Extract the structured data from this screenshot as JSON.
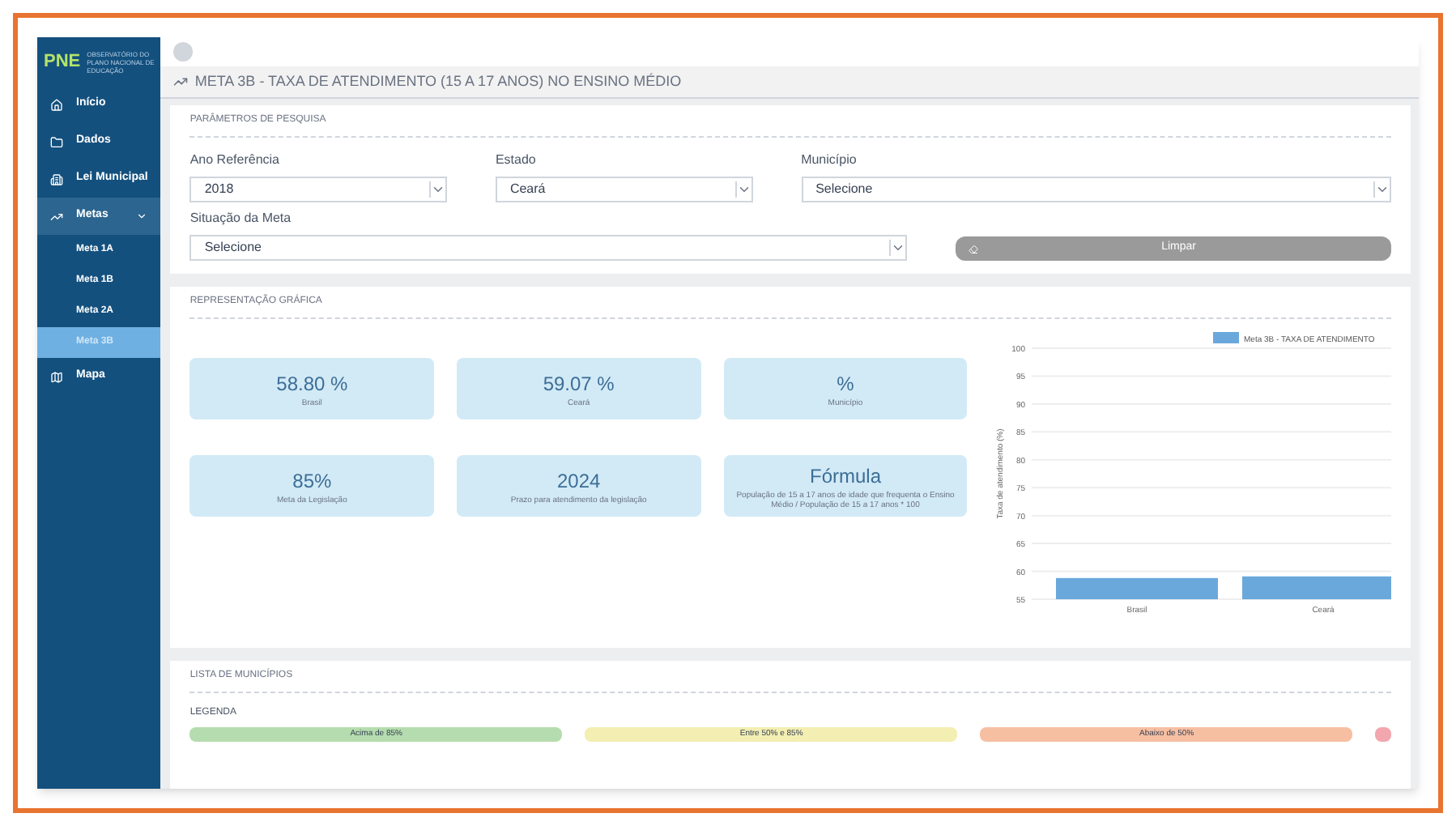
{
  "brand": {
    "logo": "PNE",
    "subtitle": "OBSERVATÓRIO DO PLANO NACIONAL DE EDUCAÇÃO"
  },
  "sidebar": {
    "items": [
      {
        "label": "Início",
        "selected": false
      },
      {
        "label": "Dados",
        "selected": false
      },
      {
        "label": "Lei Municipal",
        "selected": false
      },
      {
        "label": "Metas",
        "selected": true,
        "expanded": true,
        "children": [
          {
            "label": "Meta 1A",
            "selected": false
          },
          {
            "label": "Meta 1B",
            "selected": false
          },
          {
            "label": "Meta 2A",
            "selected": false
          },
          {
            "label": "Meta 3B",
            "selected": true
          }
        ]
      },
      {
        "label": "Mapa",
        "selected": false
      }
    ]
  },
  "header": {
    "title": "META 3B - TAXA DE ATENDIMENTO (15 A 17 ANOS) NO ENSINO MÉDIO"
  },
  "search": {
    "title": "PARÂMETROS DE PESQUISA",
    "fields": [
      {
        "label": "Ano Referência",
        "value": "2018"
      },
      {
        "label": "Estado",
        "value": "Ceará"
      },
      {
        "label": "Município",
        "value": "Selecione"
      },
      {
        "label": "Situação da Meta",
        "value": "Selecione"
      }
    ],
    "clear_button": "Limpar"
  },
  "graphic": {
    "title": "REPRESENTAÇÃO GRÁFICA",
    "cards": [
      {
        "value": "58.80 %",
        "caption": "Brasil"
      },
      {
        "value": "59.07 %",
        "caption": "Ceará"
      },
      {
        "value": "%",
        "caption": "Município"
      },
      {
        "value": "85%",
        "caption": "Meta da Legislação"
      },
      {
        "value": "2024",
        "caption": "Prazo para atendimento da legislação"
      },
      {
        "value": "Fórmula",
        "caption": "População de 15 a 17 anos de idade que frequenta o Ensino Médio / População de 15 a 17 anos * 100"
      }
    ],
    "chart_data": {
      "type": "bar",
      "ylabel": "Taxa de atendimento (%)",
      "categories": [
        "Brasil",
        "Ceará"
      ],
      "series": [
        {
          "name": "Meta 3B - TAXA DE ATENDIMENTO",
          "color": "#6aa8dc",
          "values": [
            58.8,
            59.1
          ]
        }
      ],
      "grid": true,
      "ylim": [
        55,
        100
      ],
      "yticks": [
        55,
        60,
        65,
        70,
        75,
        80,
        85,
        90,
        95,
        100
      ]
    }
  },
  "list": {
    "title": "LISTA DE MUNICÍPIOS",
    "legend_title": "LEGENDA",
    "legend": [
      {
        "label": "Acima de 85%",
        "color": "#b5dcae"
      },
      {
        "label": "Entre 50% e 85%",
        "color": "#f3eeb2"
      },
      {
        "label": "Abaixo de 50%",
        "color": "#f7bfa2"
      },
      {
        "color": "#f2a7ae"
      }
    ]
  }
}
